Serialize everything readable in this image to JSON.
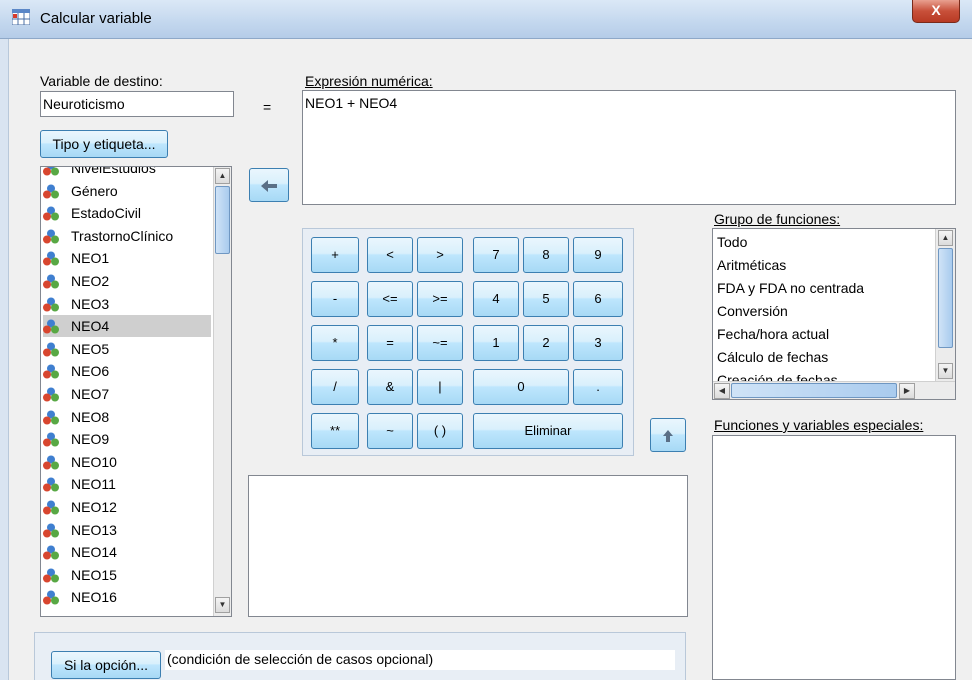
{
  "window": {
    "title": "Calcular variable",
    "close_glyph": "X"
  },
  "target": {
    "label": "Variable de destino:",
    "value": "Neuroticismo",
    "equals": "=",
    "type_label_button": "Tipo y etiqueta..."
  },
  "expression": {
    "label": "Expresión numérica:",
    "value": "NEO1 + NEO4"
  },
  "variables": [
    {
      "name": "NivelEstudios",
      "selected": false
    },
    {
      "name": "Género",
      "selected": false
    },
    {
      "name": "EstadoCivil",
      "selected": false
    },
    {
      "name": "TrastornoClínico",
      "selected": false
    },
    {
      "name": "NEO1",
      "selected": false
    },
    {
      "name": "NEO2",
      "selected": false
    },
    {
      "name": "NEO3",
      "selected": false
    },
    {
      "name": "NEO4",
      "selected": true
    },
    {
      "name": "NEO5",
      "selected": false
    },
    {
      "name": "NEO6",
      "selected": false
    },
    {
      "name": "NEO7",
      "selected": false
    },
    {
      "name": "NEO8",
      "selected": false
    },
    {
      "name": "NEO9",
      "selected": false
    },
    {
      "name": "NEO10",
      "selected": false
    },
    {
      "name": "NEO11",
      "selected": false
    },
    {
      "name": "NEO12",
      "selected": false
    },
    {
      "name": "NEO13",
      "selected": false
    },
    {
      "name": "NEO14",
      "selected": false
    },
    {
      "name": "NEO15",
      "selected": false
    },
    {
      "name": "NEO16",
      "selected": false
    }
  ],
  "keypad": {
    "plus": "+",
    "lt": "<",
    "gt": ">",
    "k7": "7",
    "k8": "8",
    "k9": "9",
    "minus": "-",
    "le": "<=",
    "ge": ">=",
    "k4": "4",
    "k5": "5",
    "k6": "6",
    "mult": "*",
    "eq": "=",
    "ne": "~=",
    "k1": "1",
    "k2": "2",
    "k3": "3",
    "div": "/",
    "and": "&",
    "or": "|",
    "k0": "0",
    "dot": ".",
    "pow": "**",
    "not": "~",
    "paren": "( )",
    "delete": "Eliminar"
  },
  "function_groups": {
    "label": "Grupo de funciones:",
    "items": [
      "Todo",
      "Aritméticas",
      "FDA y FDA no centrada",
      "Conversión",
      "Fecha/hora actual",
      "Cálculo de fechas",
      "Creación de fechas"
    ]
  },
  "special_functions": {
    "label": "Funciones y variables especiales:"
  },
  "if_option": {
    "button": "Si la opción...",
    "condition_text": "(condición de selección de casos opcional)"
  },
  "icons": {
    "app": "calculator-table-icon",
    "variable": "nominal-variable-icon",
    "move_left": "arrow-left-icon",
    "move_up": "arrow-up-icon"
  }
}
